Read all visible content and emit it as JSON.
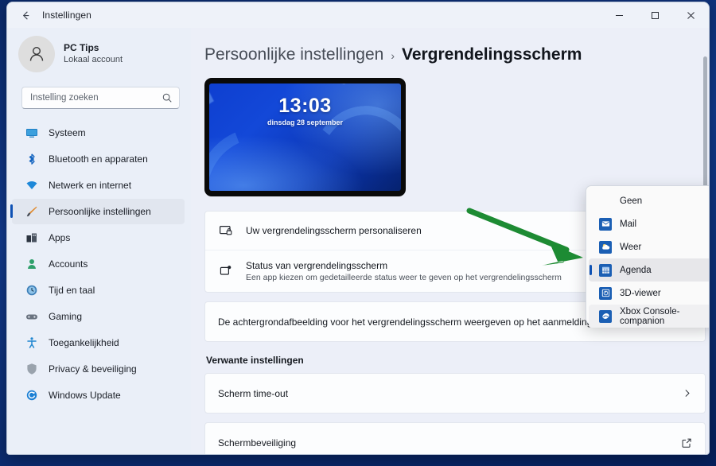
{
  "window": {
    "title": "Instellingen",
    "back_label": "terug",
    "minimize_label": "Minimaliseren",
    "maximize_label": "Maximaliseren",
    "close_label": "Sluiten"
  },
  "sidebar": {
    "account": {
      "name": "PC Tips",
      "subtitle": "Lokaal account",
      "avatar_icon": "person-icon"
    },
    "search": {
      "placeholder": "Instelling zoeken",
      "value": "",
      "icon": "search-icon"
    },
    "items": [
      {
        "label": "Systeem",
        "icon": "monitor-icon",
        "active": false
      },
      {
        "label": "Bluetooth en apparaten",
        "icon": "bluetooth-icon",
        "active": false
      },
      {
        "label": "Netwerk en internet",
        "icon": "wifi-icon",
        "active": false
      },
      {
        "label": "Persoonlijke instellingen",
        "icon": "paintbrush-icon",
        "active": true
      },
      {
        "label": "Apps",
        "icon": "apps-icon",
        "active": false
      },
      {
        "label": "Accounts",
        "icon": "account-icon",
        "active": false
      },
      {
        "label": "Tijd en taal",
        "icon": "clock-icon",
        "active": false
      },
      {
        "label": "Gaming",
        "icon": "gamepad-icon",
        "active": false
      },
      {
        "label": "Toegankelijkheid",
        "icon": "accessibility-icon",
        "active": false
      },
      {
        "label": "Privacy & beveiliging",
        "icon": "shield-icon",
        "active": false
      },
      {
        "label": "Windows Update",
        "icon": "update-icon",
        "active": false
      }
    ]
  },
  "main": {
    "breadcrumb": {
      "parent": "Persoonlijke instellingen",
      "separator": "›",
      "current": "Vergrendelingsscherm"
    },
    "preview": {
      "time": "13:03",
      "date": "dinsdag 28 september"
    },
    "rows": [
      {
        "title": "Uw vergrendelingsscherm personaliseren",
        "subtitle": "",
        "icon": "lockscreen-personalize-icon"
      },
      {
        "title": "Status van vergrendelingsscherm",
        "subtitle": "Een app kiezen om gedetailleerde status weer te geven op het vergrendelingsscherm",
        "icon": "lockscreen-status-icon"
      }
    ],
    "toggle_row": {
      "title": "De achtergrondafbeelding voor het vergrendelingsscherm weergeven op het aanmeldingsscherm"
    },
    "related": {
      "section_title": "Verwante instellingen",
      "items": [
        {
          "title": "Scherm time-out",
          "right_icon": "chevron-right-icon"
        },
        {
          "title": "Schermbeveiliging",
          "right_icon": "external-link-icon"
        }
      ]
    }
  },
  "dropdown": {
    "items": [
      {
        "label": "Geen",
        "icon": "",
        "state": "none"
      },
      {
        "label": "Mail",
        "icon": "mail-icon",
        "state": "normal"
      },
      {
        "label": "Weer",
        "icon": "weather-icon",
        "state": "normal"
      },
      {
        "label": "Agenda",
        "icon": "calendar-icon",
        "state": "selected"
      },
      {
        "label": "3D-viewer",
        "icon": "3d-viewer-icon",
        "state": "normal"
      },
      {
        "label": "Xbox Console-companion",
        "icon": "xbox-icon",
        "state": "hover"
      }
    ]
  },
  "annotation": {
    "arrow_color": "#1d8b33",
    "arrow_label": "green-pointer-arrow"
  },
  "colors": {
    "accent": "#0f52b4",
    "sidebar_bg": "#eaeff8",
    "main_bg": "#eceff8",
    "card_bg": "#fcfdfe"
  }
}
